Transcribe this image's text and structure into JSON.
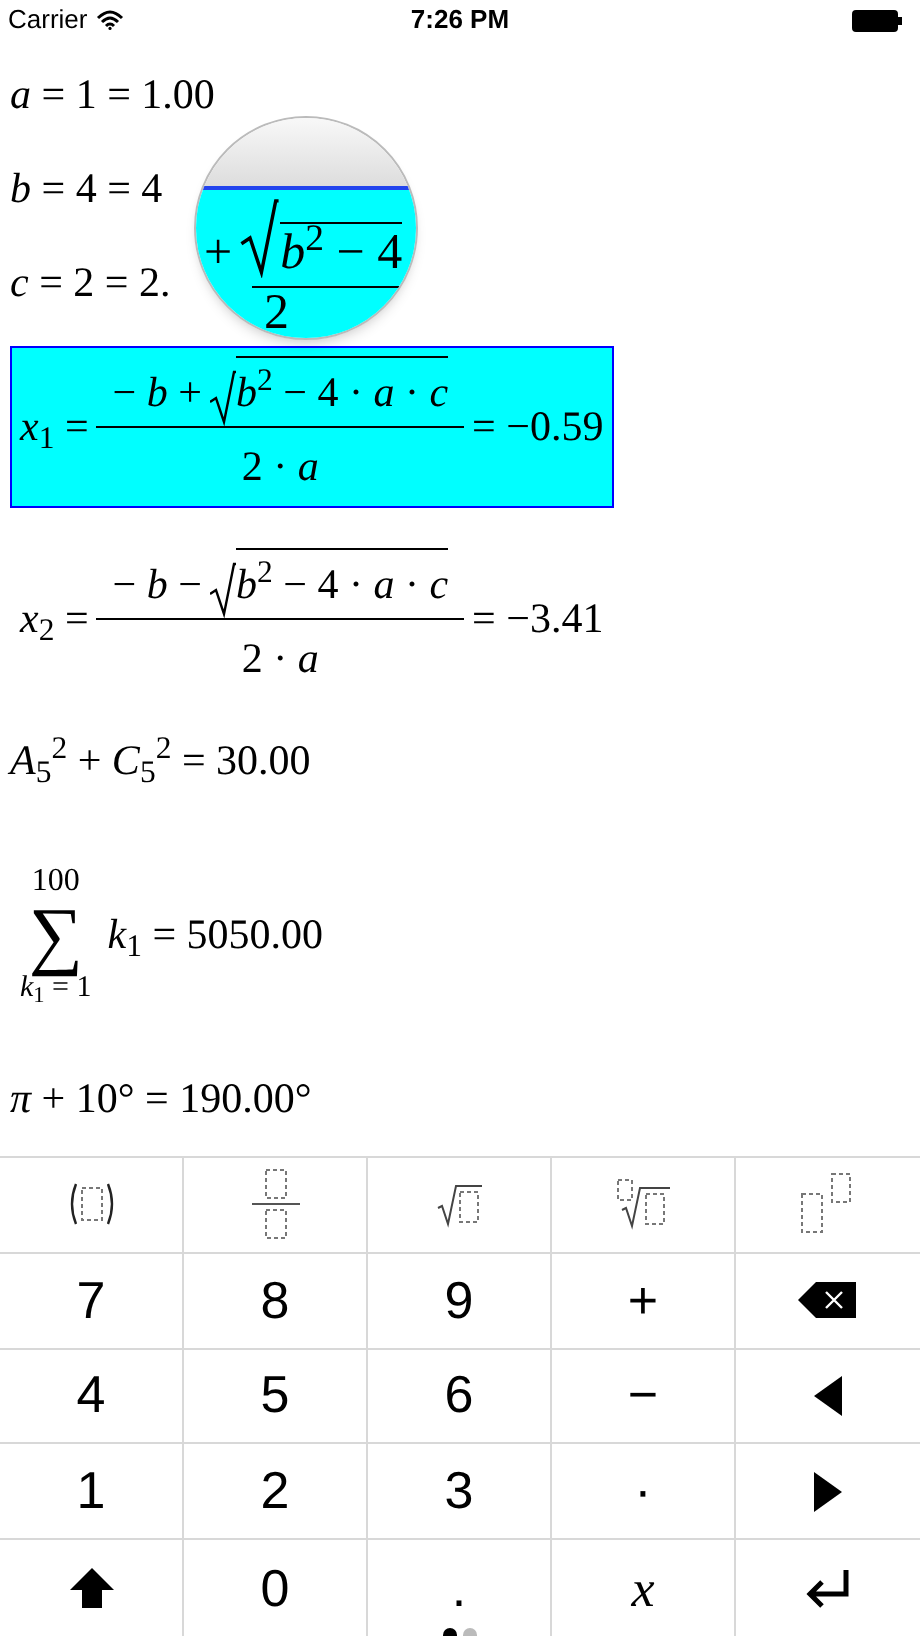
{
  "status_bar": {
    "carrier": "Carrier",
    "time": "7:26 PM"
  },
  "equations": [
    {
      "kind": "line",
      "text": "*a* = 1 = 1.00",
      "selected": false
    },
    {
      "kind": "line",
      "text": "*b* = 4 = 4",
      "selected": false
    },
    {
      "kind": "line",
      "text": "*c* = 2 = 2.",
      "selected": false
    },
    {
      "kind": "fraction",
      "lhs": "*x*$_{1}$ =",
      "prefix": "− *b* +",
      "radicand": "*b*$^{2}$ − 4 · *a* · *c*",
      "denominator": "2 · *a*",
      "result": "= −0.59",
      "selected": true
    },
    {
      "kind": "fraction",
      "lhs": "*x*$_{2}$ =",
      "prefix": "− *b* −",
      "radicand": "*b*$^{2}$ − 4 · *a* · *c*",
      "denominator": "2 · *a*",
      "result": "= −3.41",
      "selected": false
    },
    {
      "kind": "line",
      "text": "*A*$_{5}$$^{2}$ + *C*$_{5}$$^{2}$ = 30.00",
      "selected": false
    },
    {
      "kind": "sum",
      "upper": "100",
      "symbol": "∑",
      "lower": "*k*$_{1}$ = 1",
      "body": "*k*$_{1}$ = 5050.00",
      "selected": false
    },
    {
      "kind": "line",
      "text": "*π* + 10° = 190.00°",
      "selected": false
    }
  ],
  "magnifier": {
    "prefix": "+",
    "radicand": "*b*$^{2}$ − 4",
    "denominator": "2"
  },
  "keyboard": [
    {
      "kind": "parens"
    },
    {
      "kind": "fraction"
    },
    {
      "kind": "sqrt"
    },
    {
      "kind": "root"
    },
    {
      "kind": "power"
    },
    {
      "kind": "text",
      "label": "7"
    },
    {
      "kind": "text",
      "label": "8"
    },
    {
      "kind": "text",
      "label": "9"
    },
    {
      "kind": "text",
      "label": "+"
    },
    {
      "kind": "backspace"
    },
    {
      "kind": "text",
      "label": "4"
    },
    {
      "kind": "text",
      "label": "5"
    },
    {
      "kind": "text",
      "label": "6"
    },
    {
      "kind": "text",
      "label": "−"
    },
    {
      "kind": "left"
    },
    {
      "kind": "text",
      "label": "1"
    },
    {
      "kind": "text",
      "label": "2"
    },
    {
      "kind": "text",
      "label": "3"
    },
    {
      "kind": "text",
      "label": "·"
    },
    {
      "kind": "right"
    },
    {
      "kind": "shift"
    },
    {
      "kind": "text",
      "label": "0"
    },
    {
      "kind": "text",
      "label": "."
    },
    {
      "kind": "variable",
      "label": "x"
    },
    {
      "kind": "return"
    }
  ],
  "pages": [
    {
      "selected": true
    },
    {
      "selected": false
    }
  ]
}
